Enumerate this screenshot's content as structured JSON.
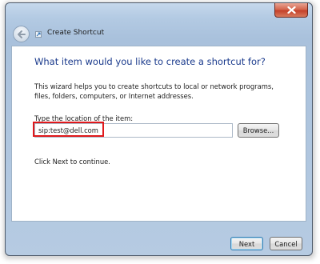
{
  "window": {
    "title": "Create Shortcut"
  },
  "icons": {
    "close": "close-icon",
    "back": "back-arrow-icon",
    "wizard": "shortcut-wizard-icon"
  },
  "main": {
    "heading": "What item would you like to create a shortcut for?",
    "description": "This wizard helps you to create shortcuts to local or network programs, files, folders, computers, or Internet addresses.",
    "location_label": "Type the location of the item:",
    "location_value": "sip:test@dell.com",
    "browse_label": "Browse...",
    "continue_text": "Click Next to continue."
  },
  "footer": {
    "next_label": "Next",
    "cancel_label": "Cancel"
  },
  "colors": {
    "heading": "#1a3a8c",
    "highlight": "#e0191c",
    "close_button": "#c4412a"
  }
}
